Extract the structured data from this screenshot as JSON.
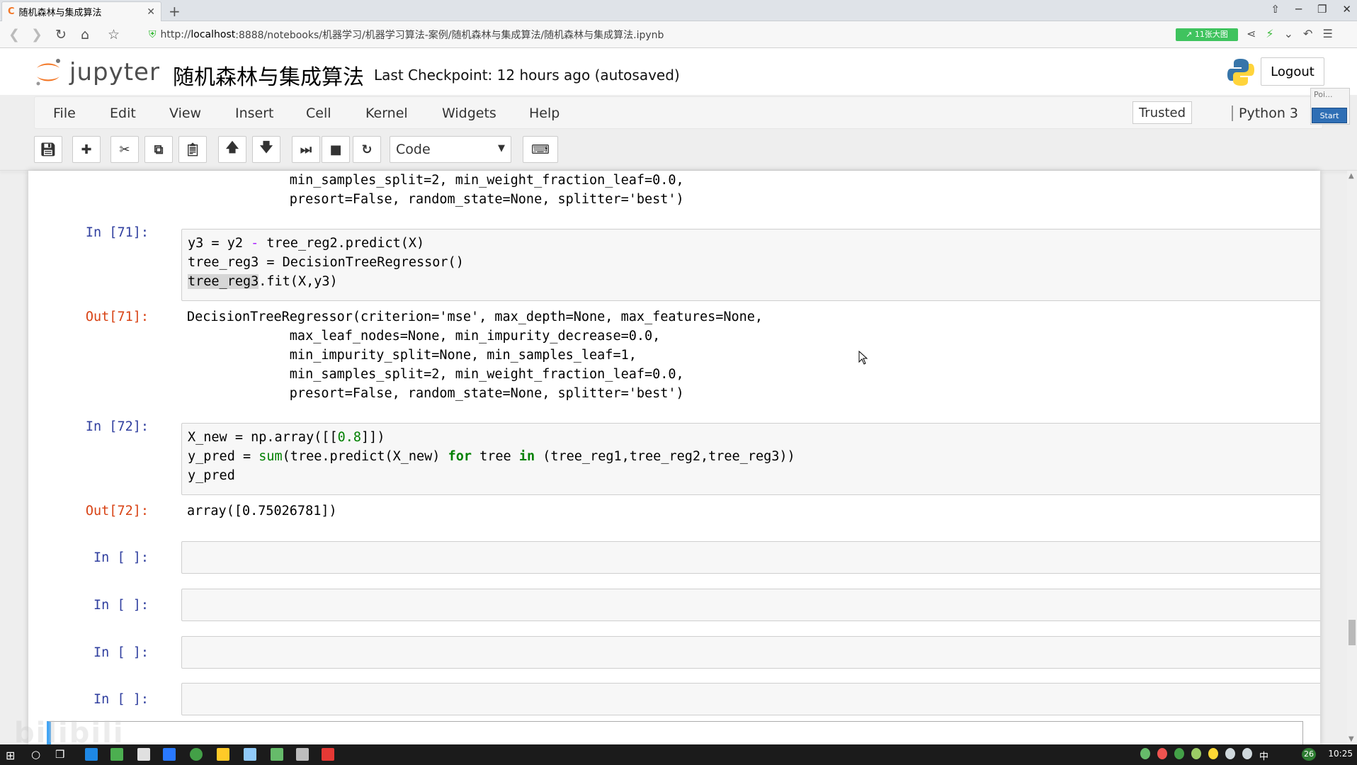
{
  "browser": {
    "tab_title": "随机森林与集成算法",
    "tab_logo": "C",
    "url_prefix": "http://",
    "url_host": "localhost",
    "url_rest": ":8888/notebooks/机器学习/机器学习算法-案例/随机森林与集成算法/随机森林与集成算法.ipynb",
    "badge": "↗ 11张大图",
    "close": "✕",
    "new_tab": "+"
  },
  "header": {
    "brand": "jupyter",
    "notebook_name": "随机森林与集成算法",
    "checkpoint": "Last Checkpoint: 12 hours ago (autosaved)",
    "logout": "Logout"
  },
  "menubar": {
    "items": [
      "File",
      "Edit",
      "View",
      "Insert",
      "Cell",
      "Kernel",
      "Widgets",
      "Help"
    ],
    "trusted": "Trusted",
    "kernel": "Python 3"
  },
  "toolbar": {
    "cell_type": "Code",
    "icons": [
      "save-icon",
      "plus-icon",
      "cut-icon",
      "copy-icon",
      "paste-icon",
      "arrow-up-icon",
      "arrow-down-icon",
      "run-icon",
      "stop-icon",
      "restart-icon",
      "keyboard-icon"
    ]
  },
  "popup": {
    "label": "Poi...",
    "start": "Start"
  },
  "cells": {
    "prev_output": {
      "line1": "             min_samples_split=2, min_weight_fraction_leaf=0.0,",
      "line2": "             presort=False, random_state=None, splitter='best')"
    },
    "c71": {
      "in_prompt": "In [71]:",
      "out_prompt": "Out[71]:",
      "out_lines": [
        "DecisionTreeRegressor(criterion='mse', max_depth=None, max_features=None,",
        "             max_leaf_nodes=None, min_impurity_decrease=0.0,",
        "             min_impurity_split=None, min_samples_leaf=1,",
        "             min_samples_split=2, min_weight_fraction_leaf=0.0,",
        "             presort=False, random_state=None, splitter='best')"
      ]
    },
    "c72": {
      "in_prompt": "In [72]:",
      "out_prompt": "Out[72]:",
      "output": "array([0.75026781])"
    },
    "empty_prompt": "In [ ]:"
  },
  "taskbar": {
    "clock": "10:25",
    "lang": "中",
    "badge": "26"
  },
  "watermark": "bilibili"
}
